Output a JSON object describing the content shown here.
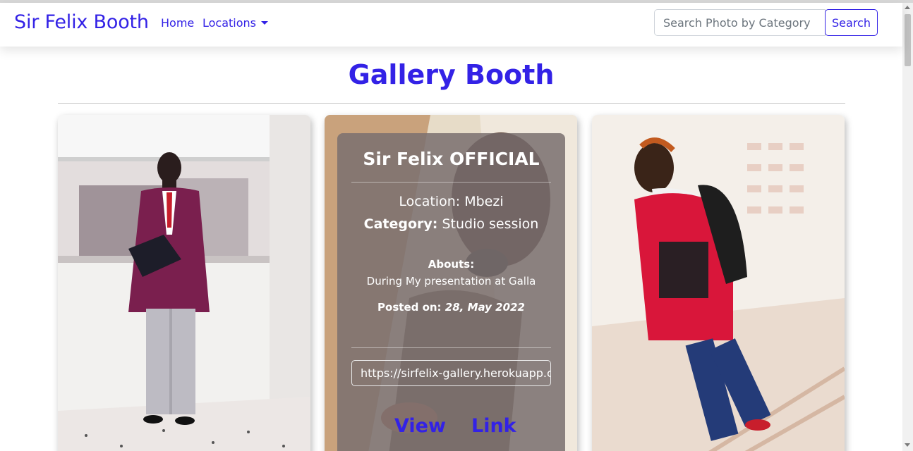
{
  "navbar": {
    "brand": "Sir Felix Booth",
    "links": [
      {
        "label": "Home"
      },
      {
        "label": "Locations"
      }
    ],
    "search": {
      "placeholder": "Search Photo by Category",
      "button": "Search"
    }
  },
  "heading": "Gallery Booth",
  "cards": [
    {
      "photo": "man-in-suit-holding-graduation-cap"
    },
    {
      "photo": "man-with-headphones",
      "overlay": {
        "title": "Sir Felix OFFICIAL",
        "location_label": "Location:",
        "location": "Mbezi",
        "category_label": "Category:",
        "category": "Studio session",
        "abouts_label": "Abouts:",
        "abouts": "During My presentation at Galla",
        "posted_label": "Posted on:",
        "posted_date": "28, May 2022",
        "url": "https://sirfelix-gallery.herokuapp.com",
        "view_label": "View",
        "link_label": "Link"
      }
    },
    {
      "photo": "man-in-red-shirt-on-stairs"
    }
  ],
  "colors": {
    "accent": "#3322e6",
    "overlay": "#7a7070"
  }
}
